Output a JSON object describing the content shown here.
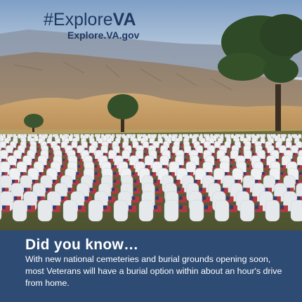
{
  "brand": {
    "hashtag_prefix": "#Explore",
    "hashtag_suffix": "VA",
    "website": "Explore.VA.gov"
  },
  "info": {
    "heading": "Did you know…",
    "body": "With new national cemeteries and burial grounds opening soon, most Veterans will have a burial option within about an hour's drive from home."
  },
  "colors": {
    "brand_text": "#1f3a63",
    "panel_background": "#2e4b73",
    "panel_text": "#ffffff"
  }
}
